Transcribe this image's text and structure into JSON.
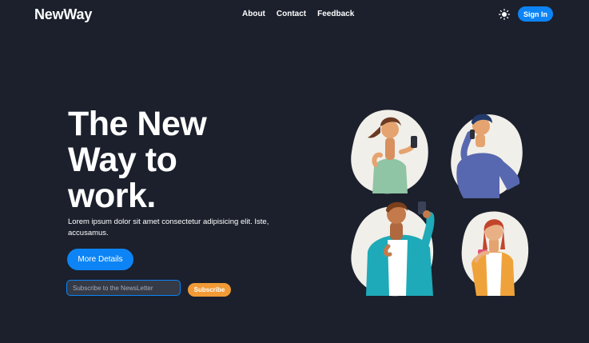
{
  "navbar": {
    "brand": "NewWay",
    "links": [
      {
        "label": "About"
      },
      {
        "label": "Contact"
      },
      {
        "label": "Feedback"
      }
    ],
    "theme_toggle_icon": "sun-icon",
    "signin_label": "Sign In"
  },
  "hero": {
    "title": "The New Way to work.",
    "subtitle": "Lorem ipsum dolor sit amet consectetur adipisicing elit. Iste, accusamus.",
    "more_details_label": "More Details",
    "newsletter": {
      "placeholder": "Subscribe to the NewsLetter",
      "value": "",
      "button_label": "Subscribe"
    }
  },
  "colors": {
    "background": "#1b202c",
    "primary": "#0d84f5",
    "accent": "#f29a35",
    "text": "#ffffff",
    "blob": "#f1efe9"
  }
}
